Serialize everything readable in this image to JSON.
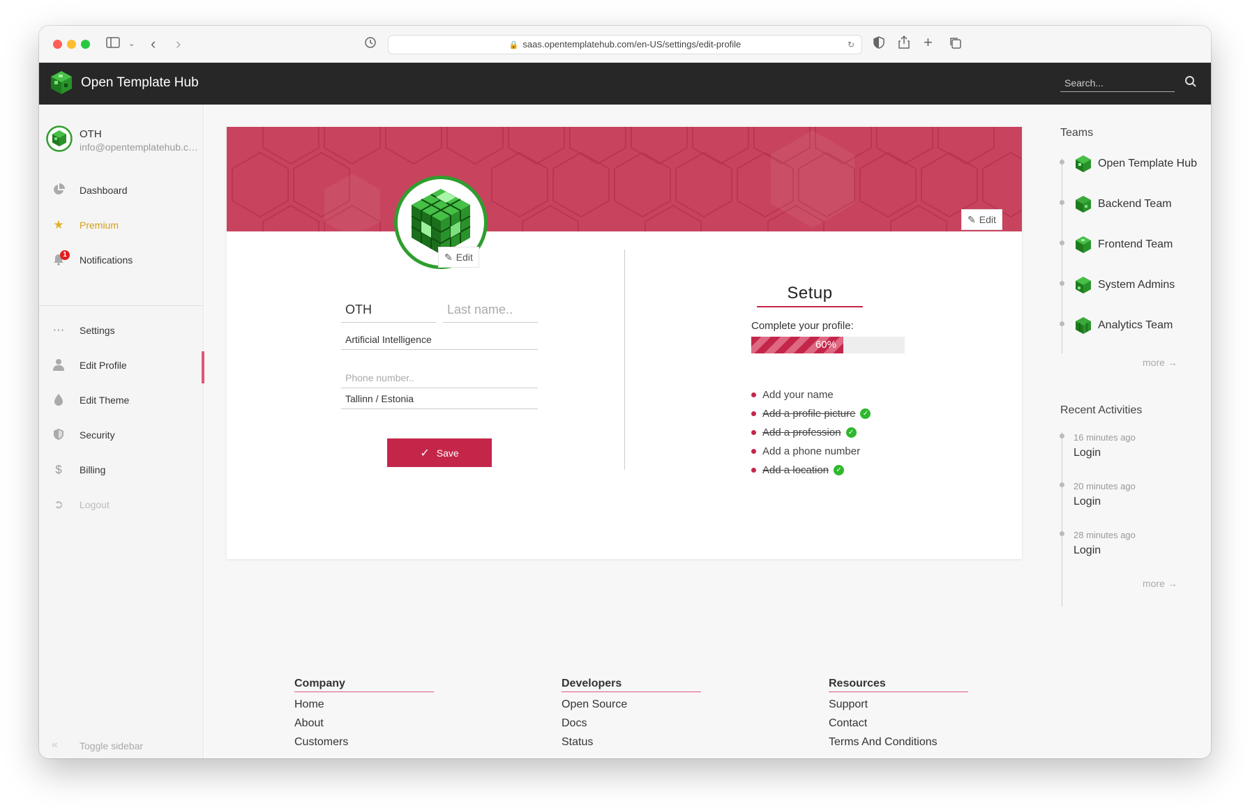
{
  "browser": {
    "url": "saas.opentemplatehub.com/en-US/settings/edit-profile"
  },
  "header": {
    "title": "Open Template Hub",
    "search_placeholder": "Search..."
  },
  "sidebar": {
    "user_name": "OTH",
    "user_email": "info@opentemplatehub.com",
    "items": [
      {
        "label": "Dashboard",
        "icon": "pie-chart-icon"
      },
      {
        "label": "Premium",
        "icon": "star-icon"
      },
      {
        "label": "Notifications",
        "icon": "bell-icon",
        "badge": "1"
      },
      {
        "label": "Settings",
        "icon": "ellipsis-icon"
      },
      {
        "label": "Edit Profile",
        "icon": "user-icon",
        "active": true
      },
      {
        "label": "Edit Theme",
        "icon": "droplet-icon"
      },
      {
        "label": "Security",
        "icon": "shield-icon"
      },
      {
        "label": "Billing",
        "icon": "dollar-icon"
      },
      {
        "label": "Logout",
        "icon": "logout-icon"
      }
    ],
    "toggle_label": "Toggle sidebar"
  },
  "profile": {
    "cover_edit_label": "Edit",
    "avatar_edit_label": "Edit",
    "first_name": "OTH",
    "last_name_placeholder": "Last name..",
    "profession": "Artificial Intelligence",
    "phone_placeholder": "Phone number..",
    "location": "Tallinn / Estonia",
    "save_label": "Save"
  },
  "setup": {
    "title": "Setup",
    "complete_label": "Complete your profile:",
    "progress_percent": 60,
    "progress_label": "60%",
    "tasks": [
      {
        "label": "Add your name",
        "done": false
      },
      {
        "label": "Add a profile picture",
        "done": true
      },
      {
        "label": "Add a profession",
        "done": true
      },
      {
        "label": "Add a phone number",
        "done": false
      },
      {
        "label": "Add a location",
        "done": true
      }
    ]
  },
  "teams": {
    "title": "Teams",
    "items": [
      "Open Template Hub",
      "Backend Team",
      "Frontend Team",
      "System Admins",
      "Analytics Team"
    ],
    "more_label": "more →"
  },
  "recent": {
    "title": "Recent Activities",
    "items": [
      {
        "time": "16 minutes ago",
        "action": "Login"
      },
      {
        "time": "20 minutes ago",
        "action": "Login"
      },
      {
        "time": "28 minutes ago",
        "action": "Login"
      }
    ],
    "more_label": "more →"
  },
  "footer": {
    "columns": [
      {
        "title": "Company",
        "links": [
          "Home",
          "About",
          "Customers"
        ]
      },
      {
        "title": "Developers",
        "links": [
          "Open Source",
          "Docs",
          "Status"
        ]
      },
      {
        "title": "Resources",
        "links": [
          "Support",
          "Contact",
          "Terms And Conditions"
        ]
      }
    ]
  },
  "colors": {
    "accent": "#c4264a",
    "cover": "#c8435e",
    "header_bg": "#272727",
    "premium": "#d4a017",
    "success": "#2eb82e"
  }
}
